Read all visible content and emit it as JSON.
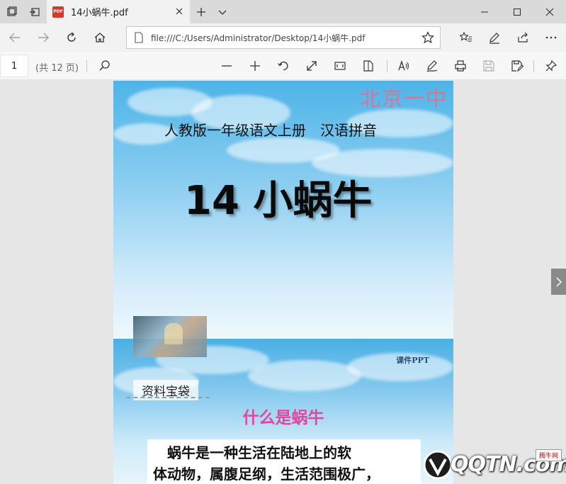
{
  "browser": {
    "tab_title": "14小蜗牛.pdf",
    "pdf_badge": "PDF",
    "url": "file:///C:/Users/Administrator/Desktop/14小蜗牛.pdf"
  },
  "pdf_toolbar": {
    "current_page": "1",
    "page_count": "(共 12 页)"
  },
  "slide1": {
    "school": "北京一中",
    "subtitle": "人教版一年级语文上册　汉语拼音",
    "title": "14 小蜗牛"
  },
  "slide2": {
    "ppt_watermark": "课件PPT",
    "info_label": "资料宝袋",
    "heading": "什么是蜗牛",
    "description_line1": "　蜗牛是一种生活在陆地上的软",
    "description_line2": "体动物，属腹足纲，生活范围极广，"
  },
  "site_watermark": {
    "text": "QQTN.com",
    "badge": "腾牛网"
  },
  "colors": {
    "tabstrip": "#dadada",
    "accent_pink": "#e2479f",
    "school_pink": "#e36f8d",
    "sky_blue": "#4db4e8"
  }
}
